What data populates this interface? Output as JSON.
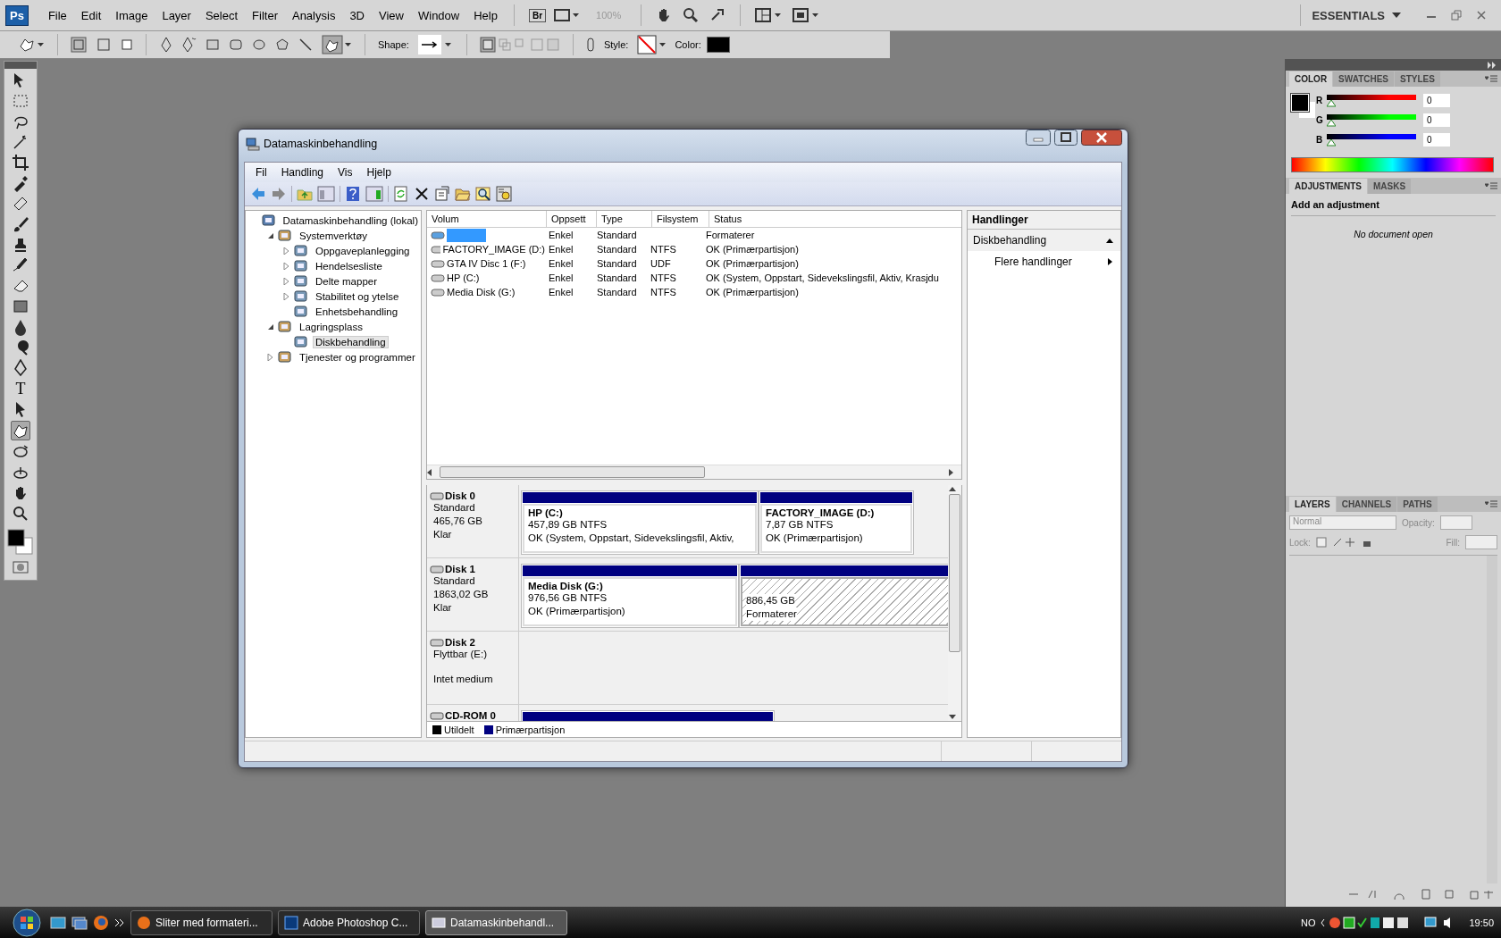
{
  "app_menu": {
    "logo": "Ps",
    "items": [
      "File",
      "Edit",
      "Image",
      "Layer",
      "Select",
      "Filter",
      "Analysis",
      "3D",
      "View",
      "Window",
      "Help"
    ],
    "bridge": "Br",
    "zoom": "100%",
    "workspace": "ESSENTIALS"
  },
  "options_bar": {
    "shape_label": "Shape:",
    "style_label": "Style:",
    "color_label": "Color:"
  },
  "tools": {
    "type_tool": "T"
  },
  "color_panel": {
    "tabs": [
      {
        "label": "COLOR",
        "selected": true
      },
      {
        "label": "SWATCHES",
        "selected": false
      },
      {
        "label": "STYLES",
        "selected": false
      }
    ],
    "channels": [
      {
        "name": "R",
        "color": "#ff0000",
        "level": 0,
        "value": "0"
      },
      {
        "name": "G",
        "color": "#00ff00",
        "level": 0,
        "value": "0"
      },
      {
        "name": "B",
        "color": "#0000ff",
        "level": 0,
        "value": "0"
      }
    ]
  },
  "adjustments_panel": {
    "tabs": [
      {
        "label": "ADJUSTMENTS",
        "selected": true
      },
      {
        "label": "MASKS",
        "selected": false
      }
    ],
    "heading": "Add an adjustment",
    "message": "No document open"
  },
  "layers_panel": {
    "tabs": [
      {
        "label": "LAYERS",
        "selected": true
      },
      {
        "label": "CHANNELS",
        "selected": false
      },
      {
        "label": "PATHS",
        "selected": false
      }
    ],
    "blend_mode": "Normal",
    "opacity_label": "Opacity:",
    "lock_label": "Lock:",
    "fill_label": "Fill:"
  },
  "window": {
    "title": "Datamaskinbehandling",
    "menu": [
      "Fil",
      "Handling",
      "Vis",
      "Hjelp"
    ],
    "tree": [
      {
        "label": "Datamaskinbehandling (lokal)",
        "selected": false,
        "children": [
          {
            "label": "Systemverktøy",
            "expanded": true,
            "selected": false,
            "children": [
              {
                "label": "Oppgaveplanlegging",
                "expanded": false,
                "selected": false
              },
              {
                "label": "Hendelsesliste",
                "expanded": false,
                "selected": false
              },
              {
                "label": "Delte mapper",
                "expanded": false,
                "selected": false
              },
              {
                "label": "Stabilitet og ytelse",
                "expanded": false,
                "selected": false
              },
              {
                "label": "Enhetsbehandling",
                "selected": false
              }
            ]
          },
          {
            "label": "Lagringsplass",
            "expanded": true,
            "selected": false,
            "children": [
              {
                "label": "Diskbehandling",
                "selected": true
              }
            ]
          },
          {
            "label": "Tjenester og programmer",
            "expanded": false,
            "selected": false
          }
        ]
      }
    ],
    "volume_table": {
      "columns": [
        "Volum",
        "Oppsett",
        "Type",
        "Filsystem",
        "Status"
      ],
      "rows": [
        {
          "selected": true,
          "layout": "Enkel",
          "type": "Standard",
          "status": "Formaterer"
        },
        {
          "selected": false,
          "volume": "FACTORY_IMAGE (D:)",
          "layout": "Enkel",
          "type": "Standard",
          "filesystem": "NTFS",
          "status": "OK (Primærpartisjon)"
        },
        {
          "selected": false,
          "volume": "GTA IV Disc 1 (F:)",
          "layout": "Enkel",
          "type": "Standard",
          "filesystem": "UDF",
          "status": "OK (Primærpartisjon)"
        },
        {
          "selected": false,
          "volume": "HP (C:)",
          "layout": "Enkel",
          "type": "Standard",
          "filesystem": "NTFS",
          "status": "OK (System, Oppstart, Sidevekslingsfil, Aktiv, Krasjdu"
        },
        {
          "selected": false,
          "volume": "Media Disk (G:)",
          "layout": "Enkel",
          "type": "Standard",
          "filesystem": "NTFS",
          "status": "OK (Primærpartisjon)"
        }
      ]
    },
    "disks": [
      {
        "name": "Disk 0",
        "lines": [
          "Standard",
          "465,76 GB",
          "Klar"
        ],
        "partitions": [
          {
            "kind": "primary",
            "title": "HP  (C:)",
            "lines": [
              "457,89 GB NTFS",
              "OK (System, Oppstart, Sidevekslingsfil, Aktiv,"
            ]
          },
          {
            "kind": "primary",
            "title": "FACTORY_IMAGE  (D:)",
            "lines": [
              "7,87 GB NTFS",
              "OK (Primærpartisjon)"
            ]
          }
        ]
      },
      {
        "name": "Disk 1",
        "lines": [
          "Standard",
          "1863,02 GB",
          "Klar"
        ],
        "partitions": [
          {
            "kind": "primary",
            "title": "Media Disk  (G:)",
            "lines": [
              "976,56 GB NTFS",
              "OK (Primærpartisjon)"
            ]
          },
          {
            "kind": "formatting",
            "lines": [
              "886,45 GB",
              "Formaterer"
            ]
          }
        ]
      },
      {
        "name": "Disk 2",
        "lines": [
          "Flyttbar (E:)",
          "Intet medium"
        ]
      },
      {
        "name": "CD-ROM 0",
        "partitions": [
          {
            "kind": "primary"
          }
        ]
      }
    ],
    "legend": [
      {
        "label": "Utildelt",
        "color": "#000000"
      },
      {
        "label": "Primærpartisjon",
        "color": "#000080"
      }
    ],
    "actions": {
      "heading": "Handlinger",
      "section": "Diskbehandling",
      "item": "Flere handlinger"
    }
  },
  "taskbar": {
    "buttons": [
      {
        "label": "Sliter med formateri...",
        "selected": false
      },
      {
        "label": "Adobe Photoshop C...",
        "selected": false
      },
      {
        "label": "Datamaskinbehandl...",
        "selected": true
      }
    ],
    "language": "NO",
    "time": "19:50"
  }
}
